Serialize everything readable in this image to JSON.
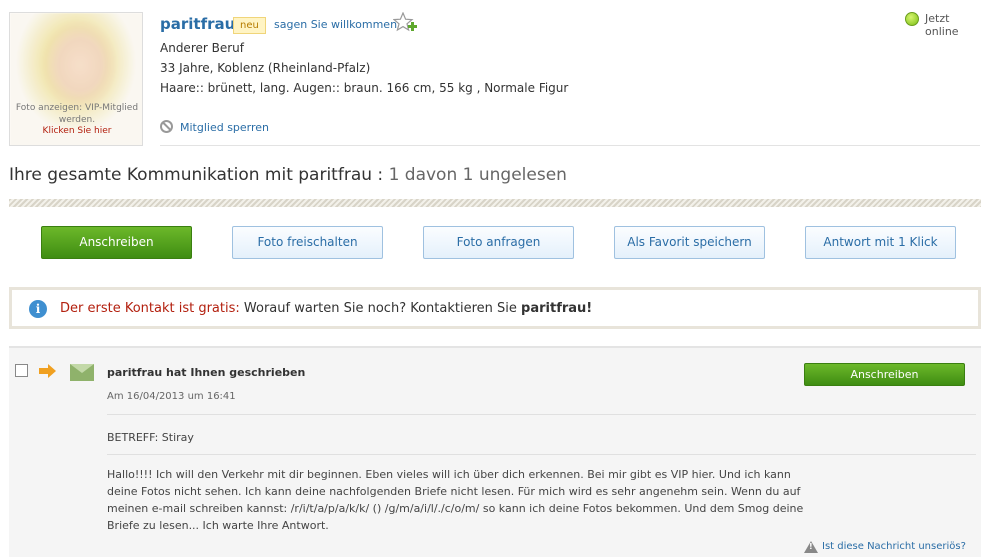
{
  "profile": {
    "photo_text": "Foto anzeigen: VIP-Mitglied werden.",
    "photo_link": "Klicken Sie hier",
    "nickname": "paritfrau",
    "badge": "neu",
    "welcome_link": "sagen Sie willkommen",
    "status": "Jetzt online",
    "job": "Anderer Beruf",
    "age_location": "33 Jahre, Koblenz (Rheinland-Pfalz)",
    "details": "Haare:: brünett, lang. Augen:: braun. 166 cm, 55 kg , Normale Figur",
    "block_link": "Mitglied sperren"
  },
  "communication": {
    "title_prefix": "Ihre gesamte Kommunikation mit paritfrau :",
    "title_count": "1 davon 1 ungelesen"
  },
  "actions": {
    "write": "Anschreiben",
    "unlock_photo": "Foto freischalten",
    "request_photo": "Foto anfragen",
    "save_favorite": "Als Favorit speichern",
    "reply_one_click": "Antwort mit 1 Klick"
  },
  "info": {
    "red_text": "Der erste Kontakt ist gratis:",
    "text": "Worauf warten Sie noch? Kontaktieren Sie",
    "name": "paritfrau!"
  },
  "message": {
    "title": "paritfrau hat Ihnen geschrieben",
    "date": "Am 16/04/2013 um 16:41",
    "button": "Anschreiben",
    "subject": "BETREFF: Stiray",
    "body": "Hallo!!!! Ich will den Verkehr mit dir beginnen. Eben vieles will ich über dich erkennen. Bei mir gibt es VIP hier. Und ich kann deine Fotos nicht sehen. Ich kann deine nachfolgenden Briefe nicht lesen. Für mich wird es sehr angenehm sein. Wenn du auf meinen e-mail schreiben kannst: /r/i/t/a/p/a/k/k/ () /g/m/a/i/l/./c/o/m/ so kann ich deine Fotos bekommen. Und dem Smog deine Briefe zu lesen... Ich warte Ihre Antwort.",
    "report_link": "Ist diese Nachricht unseriös?"
  },
  "icons": {
    "star": "star-add-icon",
    "online": "online-status-icon",
    "block": "block-icon",
    "info": "info-icon",
    "arrow": "arrow-right-icon",
    "envelope": "envelope-icon",
    "warning": "warning-icon"
  },
  "colors": {
    "link": "#2a6da6",
    "green": "#4f9e18",
    "red": "#b3200f"
  }
}
